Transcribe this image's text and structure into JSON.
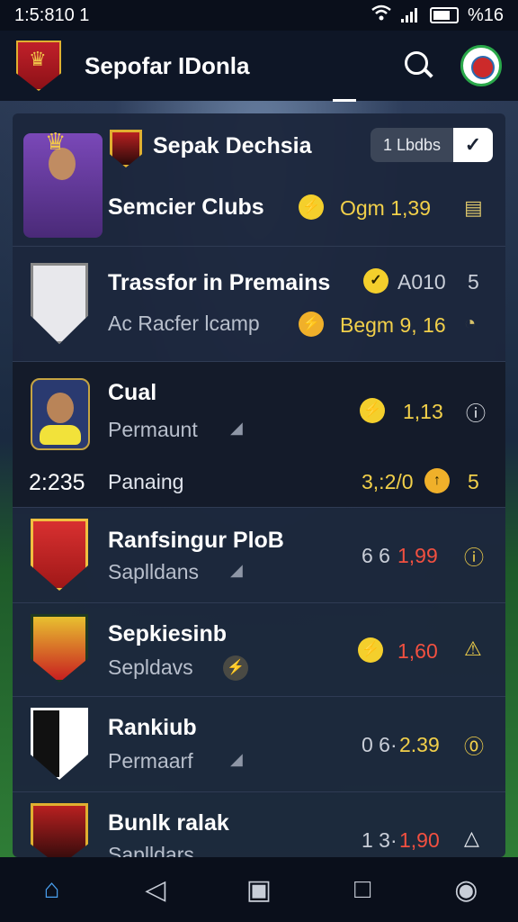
{
  "status_bar": {
    "time": "1:5:810  1",
    "battery": "%16"
  },
  "header": {
    "title": "Sepofar IDonla"
  },
  "panel_header": {
    "club_title": "Sepak Dechsia",
    "filter_label": "1 Lbdbs"
  },
  "rows": [
    {
      "title": "Semcier Clubs",
      "value": "Ogm 1,39",
      "coin": "⚡"
    },
    {
      "title": "Trassfor in Premains",
      "value1": "A010",
      "value1_tail": "5",
      "subtitle": "Ac Racfer lcamp",
      "value2": "Begm 9, 16"
    },
    {
      "title": "Cual",
      "subtitle": "Permaunt",
      "value": "1,13",
      "side_label": "2:235",
      "sub_title2": "Panaing",
      "value2": "3,:2/0",
      "trailing": "5"
    },
    {
      "title": "Ranfsingur PloB",
      "subtitle": "Saplldans",
      "value_prefix": "6 6",
      "value": "1,99"
    },
    {
      "title": "Sepkiesinb",
      "subtitle": "Sepldavs",
      "value": "1,60"
    },
    {
      "title": "Rankiub",
      "subtitle": "Permaarf",
      "value_prefix": "0 6·",
      "value": "2.39"
    },
    {
      "title": "Bunlk ralak",
      "subtitle": "Saplldars",
      "value_prefix": "1 3·",
      "value": "1,90"
    }
  ],
  "bottom_nav": [
    {
      "label": "home-icon"
    },
    {
      "label": "back-icon"
    },
    {
      "label": "bag-icon"
    },
    {
      "label": "square-icon"
    },
    {
      "label": "profile-icon"
    }
  ],
  "colors": {
    "accent_yellow": "#f2d04a",
    "accent_red": "#f25040",
    "panel": "#1c263c"
  }
}
